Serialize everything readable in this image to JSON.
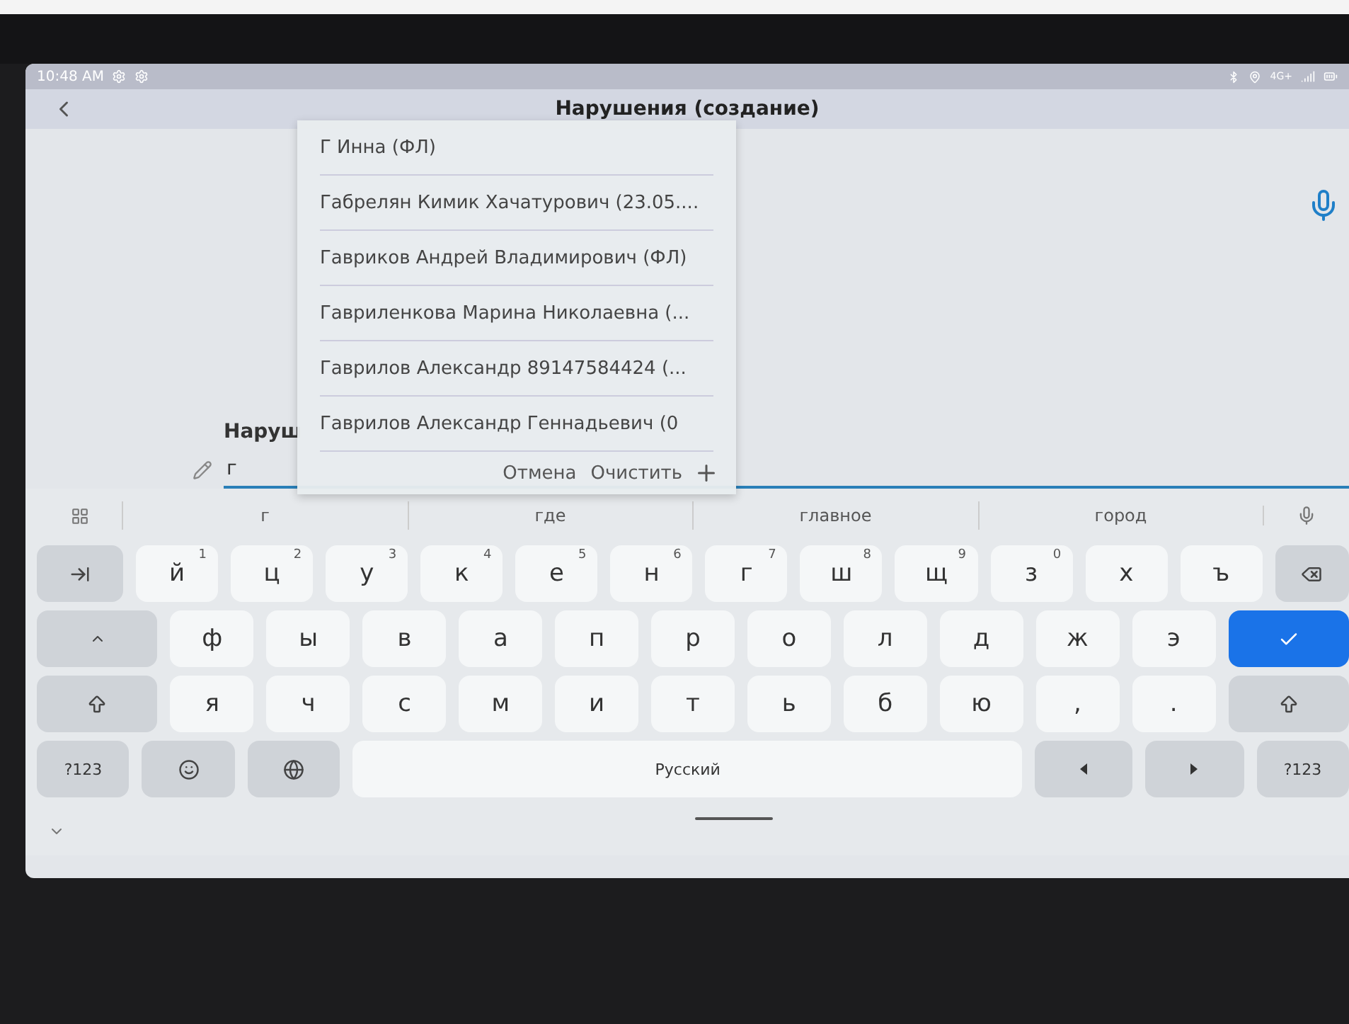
{
  "status_bar": {
    "time": "10:48 AM",
    "network": "4G+"
  },
  "header": {
    "title": "Нарушения (создание)"
  },
  "form": {
    "field_label": "Наруш",
    "field_value": "г"
  },
  "dropdown": {
    "items": [
      {
        "text": "Г Инна  (ФЛ)"
      },
      {
        "text": "Габрелян Кимик Хачатурович (23.05...."
      },
      {
        "text": "Гавриков Андрей Владимирович (ФЛ)"
      },
      {
        "text": "Гавриленкова Марина Николаевна (..."
      },
      {
        "text": "Гаврилов Александр 89147584424 (..."
      },
      {
        "text": "Гаврилов Александр Геннадьевич (0"
      }
    ],
    "actions": [
      "Отмена",
      "Очистить"
    ]
  },
  "keyboard": {
    "suggestions": [
      "г",
      "где",
      "главное",
      "город"
    ],
    "rows": [
      {
        "keys": [
          {
            "kind": "tab"
          },
          {
            "kind": "char",
            "label": "й",
            "hint": "1"
          },
          {
            "kind": "char",
            "label": "ц",
            "hint": "2"
          },
          {
            "kind": "char",
            "label": "у",
            "hint": "3"
          },
          {
            "kind": "char",
            "label": "к",
            "hint": "4"
          },
          {
            "kind": "char",
            "label": "е",
            "hint": "5"
          },
          {
            "kind": "char",
            "label": "н",
            "hint": "6"
          },
          {
            "kind": "char",
            "label": "г",
            "hint": "7"
          },
          {
            "kind": "char",
            "label": "ш",
            "hint": "8"
          },
          {
            "kind": "char",
            "label": "щ",
            "hint": "9"
          },
          {
            "kind": "char",
            "label": "з",
            "hint": "0"
          },
          {
            "kind": "char",
            "label": "х"
          },
          {
            "kind": "char",
            "label": "ъ"
          },
          {
            "kind": "backspace"
          }
        ]
      },
      {
        "keys": [
          {
            "kind": "caps"
          },
          {
            "kind": "char",
            "label": "ф"
          },
          {
            "kind": "char",
            "label": "ы"
          },
          {
            "kind": "char",
            "label": "в"
          },
          {
            "kind": "char",
            "label": "а"
          },
          {
            "kind": "char",
            "label": "п"
          },
          {
            "kind": "char",
            "label": "р"
          },
          {
            "kind": "char",
            "label": "о"
          },
          {
            "kind": "char",
            "label": "л"
          },
          {
            "kind": "char",
            "label": "д"
          },
          {
            "kind": "char",
            "label": "ж"
          },
          {
            "kind": "char",
            "label": "э"
          },
          {
            "kind": "enter"
          }
        ]
      },
      {
        "keys": [
          {
            "kind": "shift"
          },
          {
            "kind": "char",
            "label": "я"
          },
          {
            "kind": "char",
            "label": "ч"
          },
          {
            "kind": "char",
            "label": "с"
          },
          {
            "kind": "char",
            "label": "м"
          },
          {
            "kind": "char",
            "label": "и"
          },
          {
            "kind": "char",
            "label": "т"
          },
          {
            "kind": "char",
            "label": "ь"
          },
          {
            "kind": "char",
            "label": "б"
          },
          {
            "kind": "char",
            "label": "ю"
          },
          {
            "kind": "char",
            "label": ","
          },
          {
            "kind": "char",
            "label": "."
          },
          {
            "kind": "shift"
          }
        ]
      },
      {
        "keys": [
          {
            "kind": "symbols",
            "label": "?123"
          },
          {
            "kind": "emoji"
          },
          {
            "kind": "globe"
          },
          {
            "kind": "space",
            "label": "Русский"
          },
          {
            "kind": "left"
          },
          {
            "kind": "right"
          },
          {
            "kind": "symbols",
            "label": "?123"
          }
        ]
      }
    ]
  }
}
